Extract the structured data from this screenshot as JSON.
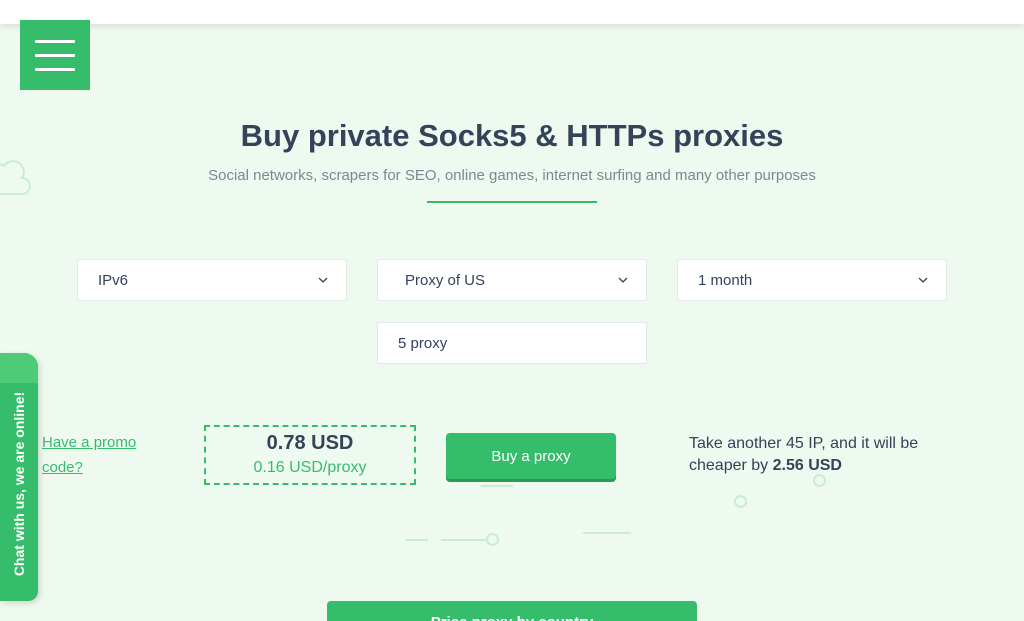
{
  "header": {
    "menu_icon": "hamburger-menu-icon"
  },
  "hero": {
    "title": "Buy private Socks5 & HTTPs proxies",
    "subtitle": "Social networks, scrapers for SEO, online games, internet surfing and many other purposes"
  },
  "form": {
    "protocol": "IPv6",
    "country": "Proxy of US",
    "period": "1 month",
    "quantity": "5 proxy"
  },
  "pricing": {
    "promo_label": "Have a promo code?",
    "total": "0.78 USD",
    "per_proxy": "0.16 USD/proxy",
    "buy_label": "Buy a proxy",
    "offer_prefix": "Take another 45 IP, and it will be cheaper by ",
    "offer_amount": "2.56 USD"
  },
  "chat": {
    "label": "Chat with us, we are online!"
  },
  "footer": {
    "bottom_button_label": "Price proxy by country"
  },
  "colors": {
    "accent": "#35bd6b",
    "text": "#34425a",
    "background": "#eefaf0"
  }
}
